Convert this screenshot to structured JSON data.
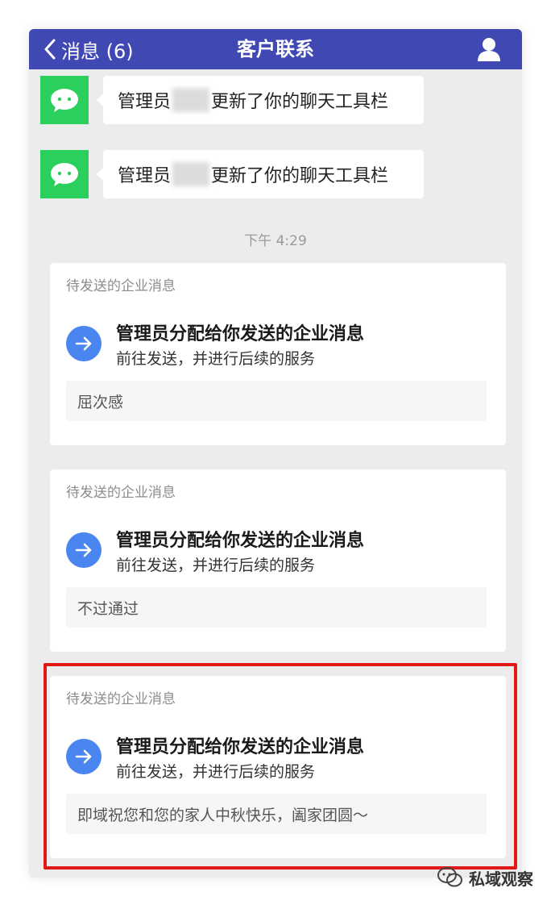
{
  "navbar": {
    "back_label": "消息 (6)",
    "title": "客户联系",
    "back_icon": "chevron-left-icon",
    "profile_icon": "person-icon"
  },
  "system_messages": [
    {
      "prefix": "管理员",
      "suffix": "更新了你的聊天工具栏",
      "icon": "wechat-icon"
    },
    {
      "prefix": "管理员",
      "suffix": "更新了你的聊天工具栏",
      "icon": "wechat-icon"
    }
  ],
  "time_label": "下午 4:29",
  "cards": [
    {
      "tag": "待发送的企业消息",
      "title": "管理员分配给你发送的企业消息",
      "subtitle": "前往发送，并进行后续的服务",
      "quote": "屈次感",
      "icon": "arrow-right-icon"
    },
    {
      "tag": "待发送的企业消息",
      "title": "管理员分配给你发送的企业消息",
      "subtitle": "前往发送，并进行后续的服务",
      "quote": "不过通过",
      "icon": "arrow-right-icon"
    },
    {
      "tag": "待发送的企业消息",
      "title": "管理员分配给你发送的企业消息",
      "subtitle": "前往发送，并进行后续的服务",
      "quote": "即域祝您和您的家人中秋快乐，阖家团圆～",
      "icon": "arrow-right-icon"
    }
  ],
  "watermark": {
    "text": "私域观察",
    "icon": "wechat-official-icon"
  },
  "colors": {
    "navbar": "#4048b4",
    "wechat_green": "#2bcf5c",
    "arrow_blue": "#4a86f0",
    "highlight_red": "#e01818",
    "background": "#ececec"
  }
}
